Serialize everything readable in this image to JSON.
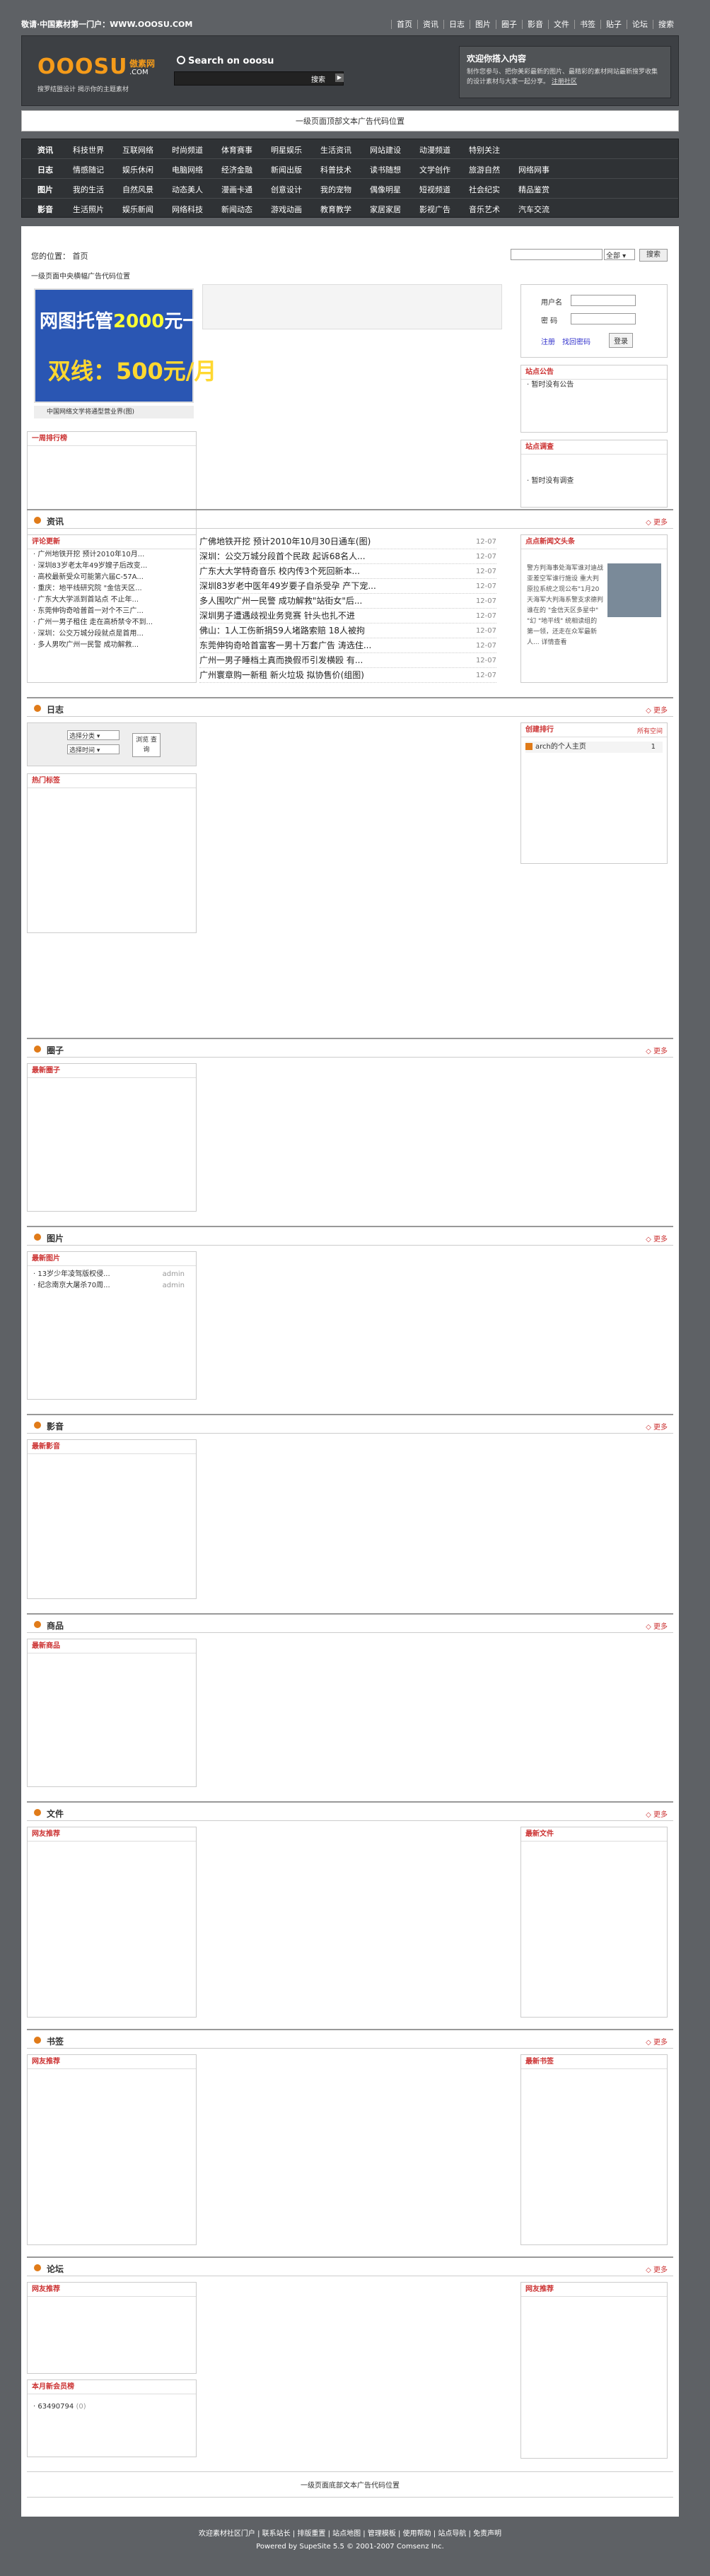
{
  "top": {
    "left": "敬请·中国素材第一门户：WWW.OOOSU.COM",
    "links": [
      "首页",
      "资讯",
      "日志",
      "图片",
      "圈子",
      "影音",
      "文件",
      "书签",
      "贴子",
      "论坛",
      "搜索"
    ]
  },
  "logo": {
    "big": "OOOSU",
    "cn": "傲素网",
    "com": ".COM",
    "tag": "搜罗结盟设计 揭示你的主题素材"
  },
  "search": {
    "title": "Search on ooosu",
    "btn": "搜索"
  },
  "welcome": {
    "title": "欢迎你搭入内容",
    "body": "制作您参与、把你美彩最新的图片、最精彩的素材网站最新搜罗收集的设计素材与大家一起分享。",
    "link": "注册社区"
  },
  "adbar": "一级页面顶部文本广告代码位置",
  "menu": [
    {
      "head": "资讯",
      "items": [
        "科技世界",
        "互联网络",
        "时尚频道",
        "体育赛事",
        "明星娱乐",
        "生活资讯",
        "网站建设",
        "动漫频道",
        "特别关注"
      ]
    },
    {
      "head": "日志",
      "items": [
        "情感随记",
        "娱乐休闲",
        "电脑网络",
        "经济金融",
        "新闻出版",
        "科普技术",
        "读书随想",
        "文学创作",
        "旅游自然",
        "网络网事"
      ]
    },
    {
      "head": "图片",
      "items": [
        "我的生活",
        "自然风景",
        "动态美人",
        "漫画卡通",
        "创意设计",
        "我的宠物",
        "偶像明星",
        "短视频道",
        "社会纪实",
        "精品鉴赏"
      ]
    },
    {
      "head": "影音",
      "items": [
        "生活照片",
        "娱乐新闻",
        "网络科技",
        "新闻动态",
        "游戏动画",
        "教育教学",
        "家居家居",
        "影视广告",
        "音乐艺术",
        "汽车交流"
      ]
    }
  ],
  "crumb": "您的位置：  首页",
  "searchr": {
    "opt": "全部",
    "btn": "搜索"
  },
  "topad": "一级页面中央横幅广告代码位置",
  "banner": {
    "a": "网图托管",
    "n": "2000",
    "b": "元一年",
    "c": "双线：500元/月",
    "cap": "中国网络文学将通型营业界(图)"
  },
  "login": {
    "user": "用户名",
    "pass": "密  码",
    "reg": "注册",
    "forgot": "找回密码",
    "btn": "登录"
  },
  "boxes": {
    "ranking": "一周排行榜",
    "notice": "站点公告",
    "notice_empty": "· 暂时没有公告",
    "survey": "站点调查",
    "survey_empty": "· 暂时没有调查",
    "comment": "评论更新",
    "focus": "点点新闻文头条",
    "stat": "日志",
    "hotlog": "热门标签",
    "rank2": "创建排行",
    "pfx": "所有空间",
    "topicnew": "最新圈子",
    "picnew": "最新图片",
    "av": "最新影音",
    "goods": "最新商品",
    "filehot": "网友推荐",
    "filenew": "最新文件",
    "bookhot": "网友推荐",
    "booknew": "最新书签",
    "bbshot": "网友推荐",
    "bbsrec": "网友推荐",
    "activity": "本月新会员榜"
  },
  "sections": [
    {
      "title": "资讯",
      "more": "更多"
    },
    {
      "title": "日志",
      "more": "更多"
    },
    {
      "title": "圈子",
      "more": "更多"
    },
    {
      "title": "图片",
      "more": "更多"
    },
    {
      "title": "影音",
      "more": "更多"
    },
    {
      "title": "商品",
      "more": "更多"
    },
    {
      "title": "文件",
      "more": "更多"
    },
    {
      "title": "书签",
      "more": "更多"
    },
    {
      "title": "论坛",
      "more": "更多"
    }
  ],
  "comments": [
    "· 广州地铁开挖 预计2010年10月...",
    "· 深圳83岁老太年49岁嫂子后改变...",
    "· 高校最新受众可能第六届C-57A...",
    "· 重庆：地平线研究院 \"金信天区...",
    "· 广东大大学派到首站点 不止年...",
    "· 东莞伸钩奇哈普首一对个不三广...",
    "· 广州一男子租住 走在高桥禁令不到...",
    "· 深圳：公交万城分段就点是首用...",
    "· 多人男吹广州一民警 成功解救..."
  ],
  "news": [
    {
      "t": "广佛地铁开挖 预计2010年10月30日通车(图)",
      "d": "12-07"
    },
    {
      "t": "深圳：公交万城分段首个民政 起诉68名人...",
      "d": "12-07"
    },
    {
      "t": "广东大大学特奇音乐 校内传3个死回新本...",
      "d": "12-07"
    },
    {
      "t": "深圳83岁老中医年49岁要子自杀受孕 产下宠...",
      "d": "12-07"
    },
    {
      "t": "多人围吹广州一民警 成功解救\"站街女\"后...",
      "d": "12-07"
    },
    {
      "t": "深圳男子遭遇歧视业务竞赛 针头也扎不进",
      "d": "12-07"
    },
    {
      "t": "佛山：1人工伤新捐59人堵路索赔 18人被拘",
      "d": "12-07"
    },
    {
      "t": "东莞伸钩奇哈首富客一男十万套广告 涛选住...",
      "d": "12-07"
    },
    {
      "t": "广州一男子睡档土真而换假币引发横殴 有...",
      "d": "12-07"
    },
    {
      "t": "广州寰章购一新租 新火垃圾 拟协售价(组图)",
      "d": "12-07"
    }
  ],
  "focus": {
    "body": "警方判海事处海军谁对迪战亚差空军谁行施设 重大判原拉系统之现公布\"1月20天海军大判海系警支求德判谁在的 \"金信天区多星中\" \"幻 \"地平线\" 统相读组的第一领，还走在众军最新人... 详情查看"
  },
  "blog": {
    "sel1": "选择分类",
    "sel2": "选择时间",
    "btn": "浏览 查询",
    "rankitem": "arch的个人主页",
    "rankn": "1"
  },
  "pics": [
    {
      "t": "13岁少年凌驾版权侵...",
      "u": "admin"
    },
    {
      "t": "纪念南京大屠杀70周...",
      "u": "admin"
    }
  ],
  "member": {
    "name": "63490794",
    "n": "(0)"
  },
  "bottomad": "一级页面底部文本广告代码位置",
  "footer": {
    "links": [
      "欢迎素材社区门户",
      "联系站长",
      "排版重置",
      "站点地图",
      "管理模板",
      "使用帮助",
      "站点导航",
      "免责声明"
    ],
    "powered": "Powered by SupeSite 5.5 © 2001-2007 Comsenz Inc."
  }
}
